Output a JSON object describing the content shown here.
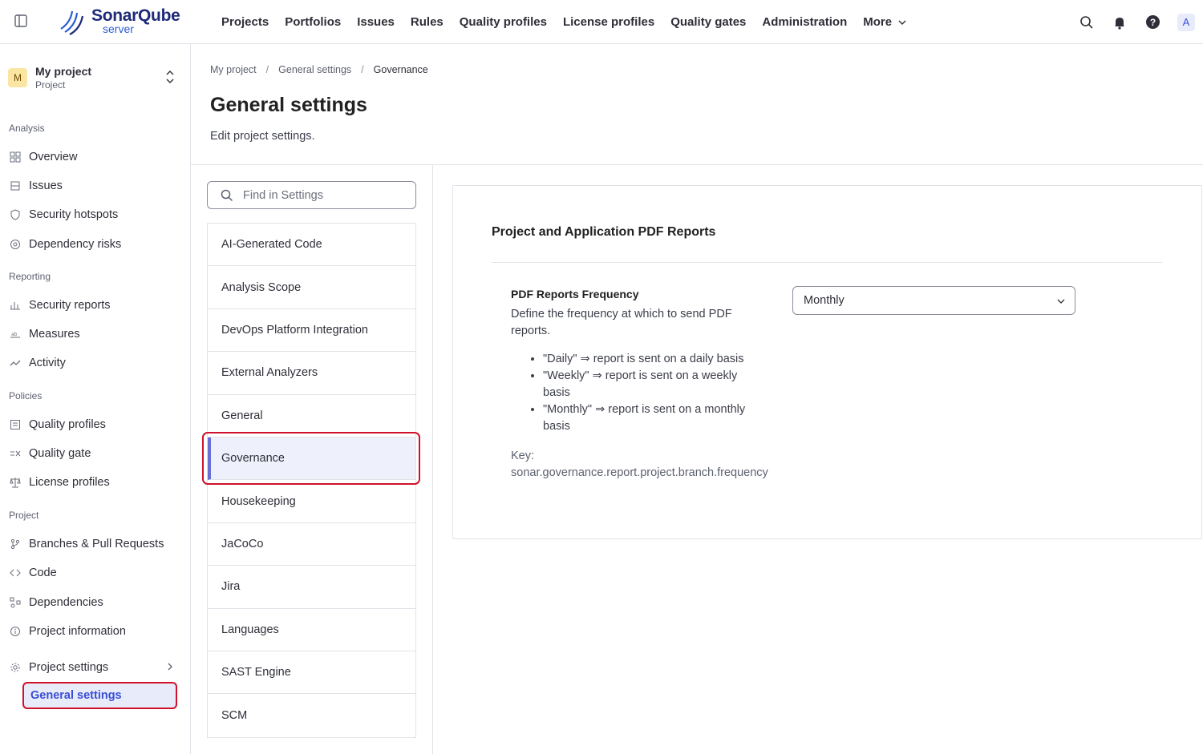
{
  "logo": {
    "name": "SonarQube",
    "sub": "server"
  },
  "topnav": [
    "Projects",
    "Portfolios",
    "Issues",
    "Rules",
    "Quality profiles",
    "License profiles",
    "Quality gates",
    "Administration",
    "More"
  ],
  "user_initial": "A",
  "project": {
    "initial": "M",
    "name": "My project",
    "type": "Project"
  },
  "sidebar": {
    "sections": [
      "Analysis",
      "Reporting",
      "Policies",
      "Project"
    ],
    "items": [
      {
        "label": "Overview",
        "icon": "overview-icon"
      },
      {
        "label": "Issues",
        "icon": "issues-icon"
      },
      {
        "label": "Security hotspots",
        "icon": "shield-icon"
      },
      {
        "label": "Dependency risks",
        "icon": "dependency-risk-icon"
      },
      {
        "label": "Security reports",
        "icon": "bar-chart-icon"
      },
      {
        "label": "Measures",
        "icon": "measures-icon"
      },
      {
        "label": "Activity",
        "icon": "activity-icon"
      },
      {
        "label": "Quality profiles",
        "icon": "quality-profiles-icon"
      },
      {
        "label": "Quality gate",
        "icon": "quality-gate-icon"
      },
      {
        "label": "License profiles",
        "icon": "scales-icon"
      },
      {
        "label": "Branches & Pull Requests",
        "icon": "branch-icon"
      },
      {
        "label": "Code",
        "icon": "code-icon"
      },
      {
        "label": "Dependencies",
        "icon": "dependencies-icon"
      },
      {
        "label": "Project information",
        "icon": "info-icon"
      },
      {
        "label": "Project settings",
        "icon": "gear-icon"
      }
    ],
    "sub_active": "General settings"
  },
  "breadcrumb": [
    "My project",
    "General settings",
    "Governance"
  ],
  "page": {
    "title": "General settings",
    "description": "Edit project settings."
  },
  "search": {
    "placeholder": "Find in Settings"
  },
  "categories": [
    "AI-Generated Code",
    "Analysis Scope",
    "DevOps Platform Integration",
    "External Analyzers",
    "General",
    "Governance",
    "Housekeeping",
    "JaCoCo",
    "Jira",
    "Languages",
    "SAST Engine",
    "SCM"
  ],
  "active_category": "Governance",
  "panel": {
    "title": "Project and Application PDF Reports",
    "setting_name": "PDF Reports Frequency",
    "setting_desc": "Define the frequency at which to send PDF reports.",
    "bullets": [
      "\"Daily\" ⇒ report is sent on a daily basis",
      "\"Weekly\" ⇒ report is sent on a weekly basis",
      "\"Monthly\" ⇒ report is sent on a monthly basis"
    ],
    "key_label": "Key:",
    "key_value": "sonar.governance.report.project.branch.frequency",
    "select_value": "Monthly"
  }
}
